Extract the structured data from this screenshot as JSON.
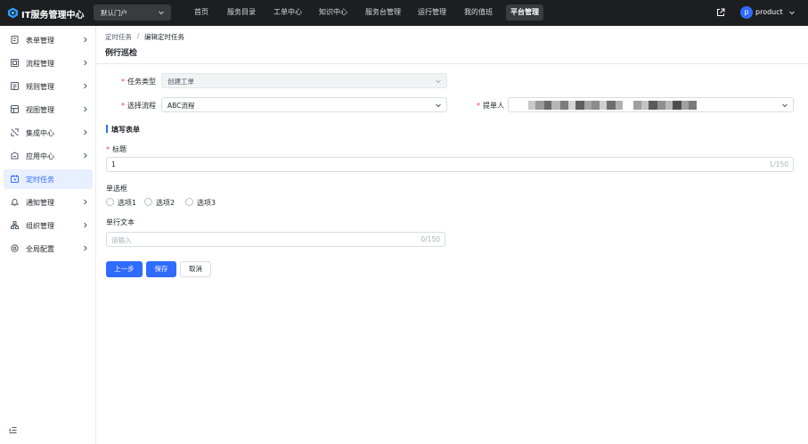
{
  "header": {
    "app_title": "IT服务管理中心",
    "portal_select": "默认门户",
    "nav": [
      "首页",
      "服务目录",
      "工单中心",
      "知识中心",
      "服务台管理",
      "运行管理",
      "我的值班",
      "平台管理"
    ],
    "active_nav": "平台管理",
    "avatar_letter": "p",
    "username": "product"
  },
  "sidebar": {
    "items": [
      {
        "label": "表单管理",
        "icon": "form-icon"
      },
      {
        "label": "流程管理",
        "icon": "flow-icon"
      },
      {
        "label": "规则管理",
        "icon": "rule-icon"
      },
      {
        "label": "视图管理",
        "icon": "view-icon"
      },
      {
        "label": "集成中心",
        "icon": "integration-icon"
      },
      {
        "label": "应用中心",
        "icon": "app-icon"
      },
      {
        "label": "定时任务",
        "icon": "schedule-icon"
      },
      {
        "label": "通知管理",
        "icon": "bell-icon"
      },
      {
        "label": "组织管理",
        "icon": "org-icon"
      },
      {
        "label": "全局配置",
        "icon": "gear-icon"
      }
    ],
    "active": "定时任务"
  },
  "breadcrumb": {
    "parent": "定时任务",
    "separator": "/",
    "current": "编辑定时任务"
  },
  "page_title": "例行巡检",
  "form": {
    "task_type_label": "任务类型",
    "task_type_value": "创建工单",
    "flow_label": "选择流程",
    "flow_value": "ABC流程",
    "submitter_label": "提单人",
    "section_title": "填写表单",
    "title_label": "标题",
    "title_value": "1",
    "title_count": "1/150",
    "radio_label": "单选框",
    "radio_options": [
      "选项1",
      "选项2",
      "选项3"
    ],
    "text_label": "单行文本",
    "text_placeholder": "请输入",
    "text_count": "0/150"
  },
  "buttons": {
    "prev": "上一步",
    "save": "保存",
    "cancel": "取消"
  },
  "colors": {
    "topbar": "#1d1e20",
    "accent": "#2f6bff",
    "required": "#f53f3f"
  }
}
